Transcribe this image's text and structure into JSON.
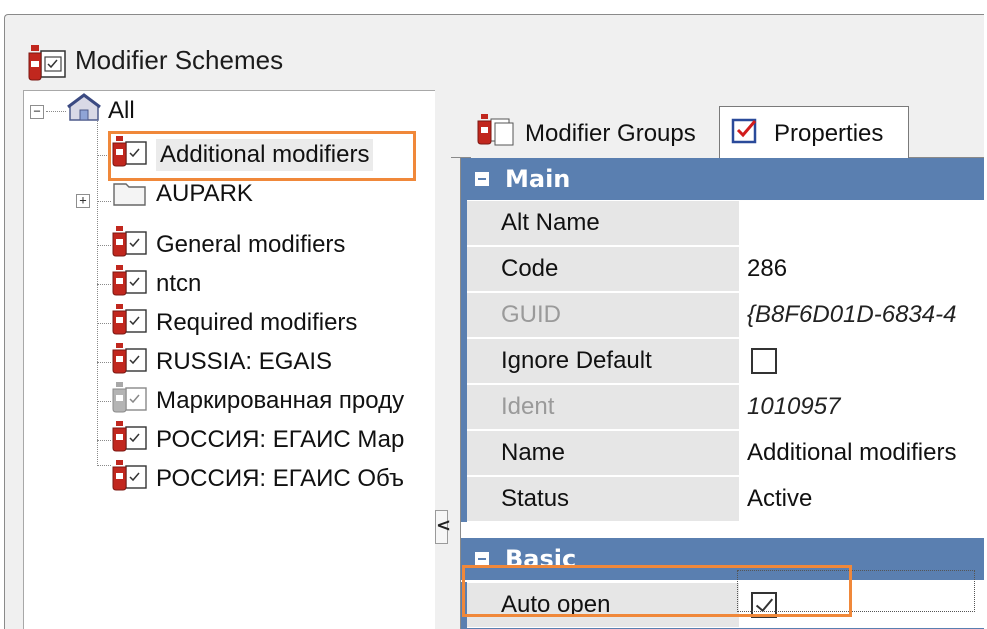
{
  "window": {
    "title": "Modifier Schemes",
    "icon": "modifier-scheme-icon"
  },
  "tree": {
    "root": {
      "label": "All",
      "icon": "house-folder-icon",
      "expanded": true
    },
    "items": [
      {
        "label": "Additional modifiers",
        "icon": "modifier-scheme-icon",
        "selected": true,
        "highlighted": true
      },
      {
        "label": "AUPARK",
        "icon": "folder-icon",
        "expandable": true
      },
      {
        "label": "General modifiers",
        "icon": "modifier-scheme-icon"
      },
      {
        "label": "ntcn",
        "icon": "modifier-scheme-icon"
      },
      {
        "label": "Required modifiers",
        "icon": "modifier-scheme-icon"
      },
      {
        "label": "RUSSIA: EGAIS",
        "icon": "modifier-scheme-icon"
      },
      {
        "label": "Маркированная проду",
        "icon": "modifier-scheme-disabled-icon"
      },
      {
        "label": "РОССИЯ: ЕГАИС Мар",
        "icon": "modifier-scheme-icon"
      },
      {
        "label": "РОССИЯ: ЕГАИС Объ",
        "icon": "modifier-scheme-icon"
      }
    ]
  },
  "splitter": {
    "collapse_glyph": "<"
  },
  "tabs": [
    {
      "label": "Modifier Groups",
      "icon": "modifier-groups-icon",
      "active": false
    },
    {
      "label": "Properties",
      "icon": "properties-checklist-icon",
      "active": true
    }
  ],
  "properties": {
    "categories": [
      {
        "name": "Main",
        "rows": [
          {
            "name": "Alt Name",
            "value": "",
            "dim": false,
            "italic": false
          },
          {
            "name": "Code",
            "value": "286",
            "dim": false,
            "italic": false
          },
          {
            "name": "GUID",
            "value": "{B8F6D01D-6834-4",
            "dim": true,
            "italic": true
          },
          {
            "name": "Ignore Default",
            "value": "",
            "checkbox": false,
            "dim": false
          },
          {
            "name": "Ident",
            "value": "1010957",
            "dim": true,
            "italic": true
          },
          {
            "name": "Name",
            "value": "Additional modifiers",
            "dim": false,
            "italic": false
          },
          {
            "name": "Status",
            "value": "Active",
            "dim": false,
            "italic": false
          }
        ]
      },
      {
        "name": "Basic",
        "rows": [
          {
            "name": "Auto open",
            "value": "",
            "checkbox": true,
            "highlighted": true
          }
        ]
      }
    ]
  },
  "colors": {
    "category_bg": "#5a7fb0",
    "highlight": "#f0883a",
    "name_cell_bg": "#e6e6e6"
  }
}
